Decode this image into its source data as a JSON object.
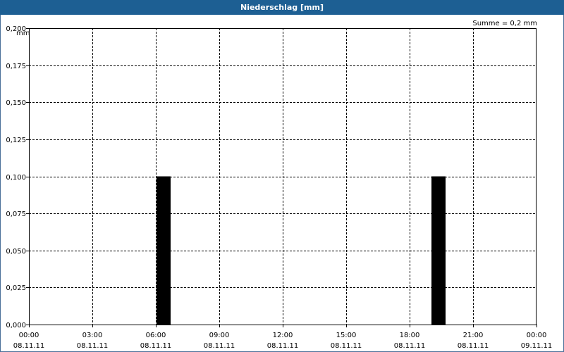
{
  "window": {
    "title": "Niederschlag [mm]"
  },
  "chart_data": {
    "type": "bar",
    "title": "Niederschlag [mm]",
    "ylabel": "mm",
    "summary": "Summe = 0,2 mm",
    "ylim": [
      0,
      0.2
    ],
    "xlim": [
      "08.11.11 00:00",
      "09.11.11 00:00"
    ],
    "y_ticks": [
      "0,000",
      "0,025",
      "0,050",
      "0,075",
      "0,100",
      "0,125",
      "0,150",
      "0,175",
      "0,200"
    ],
    "x_ticks": [
      {
        "time": "00:00",
        "date": "08.11.11"
      },
      {
        "time": "03:00",
        "date": "08.11.11"
      },
      {
        "time": "06:00",
        "date": "08.11.11"
      },
      {
        "time": "09:00",
        "date": "08.11.11"
      },
      {
        "time": "12:00",
        "date": "08.11.11"
      },
      {
        "time": "15:00",
        "date": "08.11.11"
      },
      {
        "time": "18:00",
        "date": "08.11.11"
      },
      {
        "time": "21:00",
        "date": "08.11.11"
      },
      {
        "time": "00:00",
        "date": "09.11.11"
      }
    ],
    "bars": [
      {
        "start": "08.11.11 06:00",
        "end": "08.11.11 06:40",
        "value": 0.1
      },
      {
        "start": "08.11.11 19:00",
        "end": "08.11.11 19:40",
        "value": 0.1
      }
    ],
    "grid": true,
    "colors": {
      "bar": "#000000",
      "grid": "#000000",
      "titlebar": "#1d5f93"
    }
  }
}
